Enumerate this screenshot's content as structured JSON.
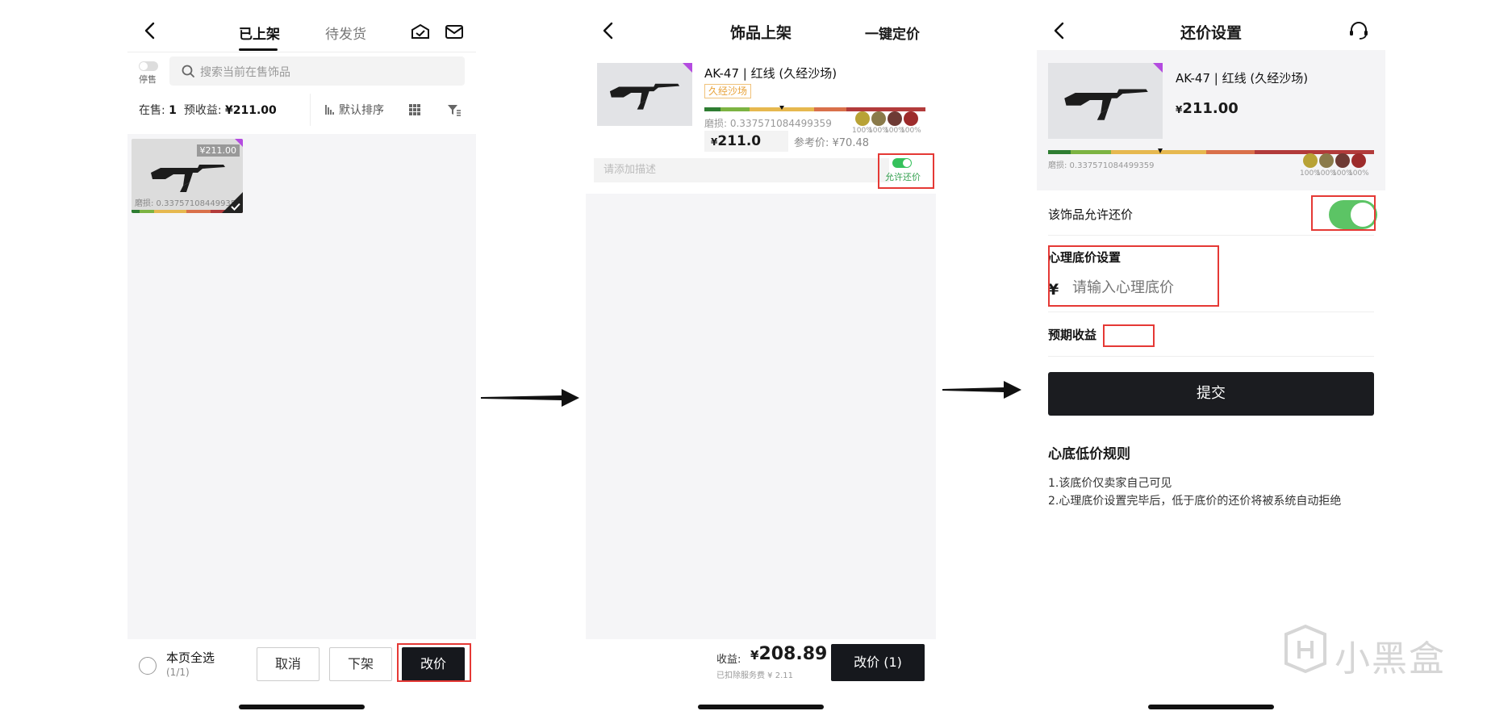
{
  "phone1": {
    "tabs": [
      {
        "label": "已上架",
        "active": true
      },
      {
        "label": "待发货",
        "active": false
      }
    ],
    "stop_label": "停售",
    "search_placeholder": "搜索当前在售饰品",
    "stats": {
      "on_sale_label": "在售:",
      "on_sale_count": "1",
      "expected_label": "预收益:",
      "expected_value": "¥211.00"
    },
    "sort_label": "默认排序",
    "item": {
      "price_tag": "¥211.00",
      "wear": "磨损: 0.337571084499359"
    },
    "bottom": {
      "select_all": "本页全选",
      "select_count": "(1/1)",
      "cancel": "取消",
      "delist": "下架",
      "reprice": "改价"
    }
  },
  "phone2": {
    "title": "饰品上架",
    "right_action": "一键定价",
    "item": {
      "name": "AK-47 | 红线 (久经沙场)",
      "badge": "久经沙场",
      "wear": "磨损: 0.337571084499359",
      "price": "211.0",
      "price_symbol": "¥",
      "ref_price": "参考价: ¥70.48",
      "sticker_pcts": [
        "100%",
        "100%",
        "100%",
        "100%"
      ]
    },
    "desc_placeholder": "请添加描述",
    "allow_bargain_label": "允许还价",
    "bottom": {
      "income_label": "收益:",
      "income_symbol": "¥",
      "income_value": "208.89",
      "fee_note": "已扣除服务费 ¥ 2.11",
      "submit": "改价 (1)"
    }
  },
  "phone3": {
    "title": "还价设置",
    "item": {
      "name": "AK-47 | 红线 (久经沙场)",
      "price_symbol": "¥",
      "price": "211.00",
      "wear": "磨损: 0.337571084499359",
      "sticker_pcts": [
        "100%",
        "100%",
        "100%",
        "100%"
      ]
    },
    "allow_bargain_label": "该饰品允许还价",
    "floor_price_label": "心理底价设置",
    "currency_symbol": "¥",
    "floor_price_placeholder": "请输入心理底价",
    "expected_income_label": "预期收益",
    "submit": "提交",
    "rules_title": "心底低价规则",
    "rules": [
      "1.该底价仅卖家自己可见",
      "2.心理底价设置完毕后，低于底价的还价将被系统自动拒绝"
    ]
  },
  "watermark": "小黑盒",
  "colors": {
    "highlight": "#e53935",
    "toggle_on": "#5cc465",
    "rarity": "#b44be0",
    "dark_button": "#16181d"
  }
}
